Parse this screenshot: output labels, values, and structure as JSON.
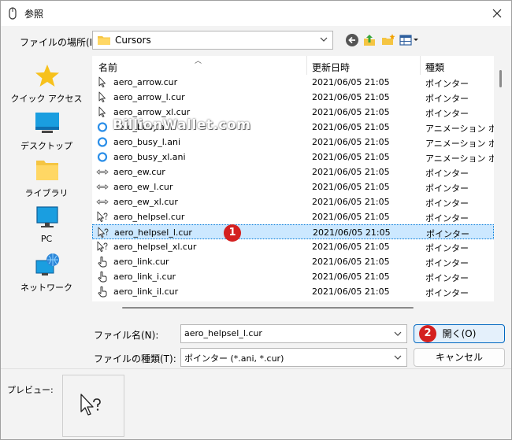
{
  "window": {
    "title": "参照"
  },
  "location": {
    "label": "ファイルの場所(I):",
    "value": "Cursors"
  },
  "sidebar": {
    "items": [
      {
        "label": "クイック アクセス",
        "icon": "star-icon"
      },
      {
        "label": "デスクトップ",
        "icon": "desktop-icon"
      },
      {
        "label": "ライブラリ",
        "icon": "library-icon"
      },
      {
        "label": "PC",
        "icon": "pc-icon"
      },
      {
        "label": "ネットワーク",
        "icon": "network-icon"
      }
    ]
  },
  "columns": {
    "name": "名前",
    "date": "更新日時",
    "type": "種類"
  },
  "files": [
    {
      "name": "aero_arrow.cur",
      "date": "2021/06/05 21:05",
      "type": "ポインター",
      "icon": "arrow-cursor-icon"
    },
    {
      "name": "aero_arrow_l.cur",
      "date": "2021/06/05 21:05",
      "type": "ポインター",
      "icon": "arrow-cursor-icon"
    },
    {
      "name": "aero_arrow_xl.cur",
      "date": "2021/06/05 21:05",
      "type": "ポインター",
      "icon": "arrow-cursor-icon"
    },
    {
      "name": "aero_busy.ani",
      "date": "2021/06/05 21:05",
      "type": "アニメーション ポインター",
      "icon": "busy-ring-icon"
    },
    {
      "name": "aero_busy_l.ani",
      "date": "2021/06/05 21:05",
      "type": "アニメーション ポインター",
      "icon": "busy-ring-icon"
    },
    {
      "name": "aero_busy_xl.ani",
      "date": "2021/06/05 21:05",
      "type": "アニメーション ポインター",
      "icon": "busy-ring-icon"
    },
    {
      "name": "aero_ew.cur",
      "date": "2021/06/05 21:05",
      "type": "ポインター",
      "icon": "ew-resize-icon"
    },
    {
      "name": "aero_ew_l.cur",
      "date": "2021/06/05 21:05",
      "type": "ポインター",
      "icon": "ew-resize-icon"
    },
    {
      "name": "aero_ew_xl.cur",
      "date": "2021/06/05 21:05",
      "type": "ポインター",
      "icon": "ew-resize-icon"
    },
    {
      "name": "aero_helpsel.cur",
      "date": "2021/06/05 21:05",
      "type": "ポインター",
      "icon": "help-cursor-icon"
    },
    {
      "name": "aero_helpsel_l.cur",
      "date": "2021/06/05 21:05",
      "type": "ポインター",
      "icon": "help-cursor-icon",
      "selected": true
    },
    {
      "name": "aero_helpsel_xl.cur",
      "date": "2021/06/05 21:05",
      "type": "ポインター",
      "icon": "help-cursor-icon"
    },
    {
      "name": "aero_link.cur",
      "date": "2021/06/05 21:05",
      "type": "ポインター",
      "icon": "hand-cursor-icon"
    },
    {
      "name": "aero_link_i.cur",
      "date": "2021/06/05 21:05",
      "type": "ポインター",
      "icon": "hand-cursor-icon"
    },
    {
      "name": "aero_link_il.cur",
      "date": "2021/06/05 21:05",
      "type": "ポインター",
      "icon": "hand-cursor-icon"
    }
  ],
  "watermark": "BillionWallet.com",
  "filename": {
    "label": "ファイル名(N):",
    "value": "aero_helpsel_l.cur"
  },
  "filetype": {
    "label": "ファイルの種類(T):",
    "value": "ポインター (*.ani, *.cur)"
  },
  "buttons": {
    "open": "開く(O)",
    "cancel": "キャンセル"
  },
  "badges": {
    "one": "1",
    "two": "2"
  },
  "preview": {
    "label": "プレビュー:"
  },
  "colors": {
    "selection": "#cce8ff",
    "badge": "#d42020",
    "accent": "#0067c0"
  }
}
